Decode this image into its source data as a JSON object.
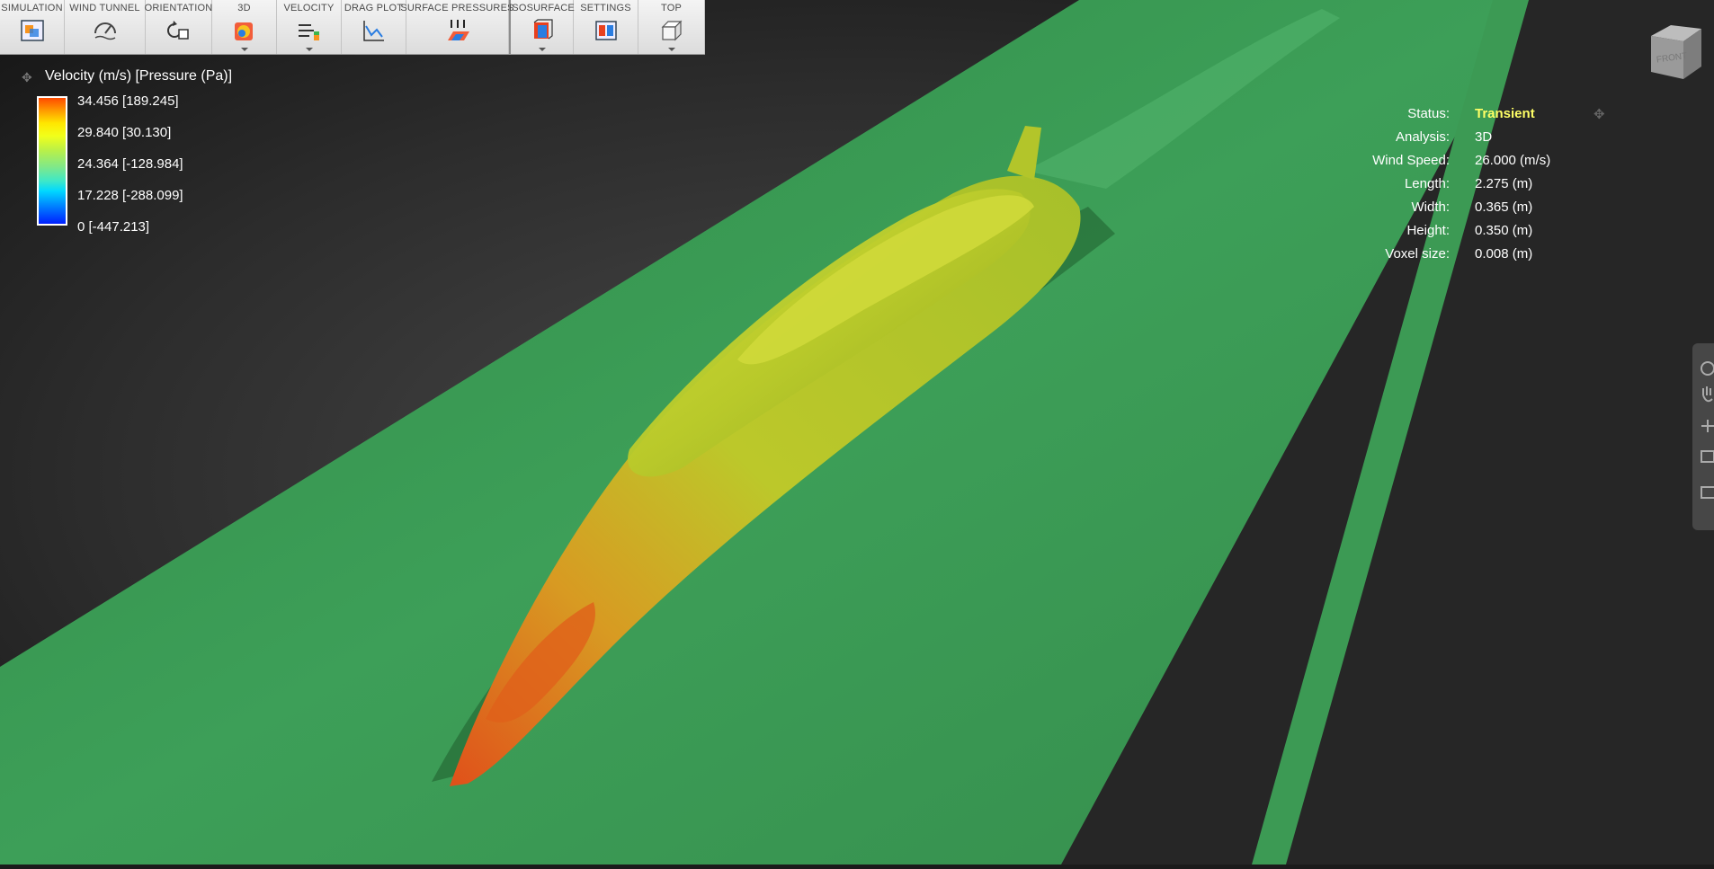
{
  "toolbar": {
    "items": [
      {
        "label": "SIMULATION",
        "icon": "simulation-icon"
      },
      {
        "label": "WIND TUNNEL",
        "icon": "wind-tunnel-icon"
      },
      {
        "label": "ORIENTATION",
        "icon": "orientation-icon"
      },
      {
        "label": "3D",
        "icon": "3d-view-icon"
      },
      {
        "label": "VELOCITY",
        "icon": "velocity-icon"
      },
      {
        "label": "DRAG PLOT",
        "icon": "drag-plot-icon"
      },
      {
        "label": "SURFACE PRESSURES",
        "icon": "surface-pressures-icon"
      },
      {
        "label": "ISOSURFACE",
        "icon": "isosurface-icon"
      },
      {
        "label": "SETTINGS",
        "icon": "settings-icon"
      },
      {
        "label": "TOP",
        "icon": "top-view-icon"
      }
    ]
  },
  "legend": {
    "title": "Velocity (m/s) [Pressure (Pa)]",
    "values": [
      "34.456 [189.245]",
      "29.840 [30.130]",
      "24.364 [-128.984]",
      "17.228 [-288.099]",
      "0 [-447.213]"
    ]
  },
  "status": {
    "rows": [
      {
        "label": "Status:",
        "value": "Transient"
      },
      {
        "label": "Analysis:",
        "value": "3D"
      },
      {
        "label": "Wind Speed:",
        "value": "26.000 (m/s)"
      },
      {
        "label": "Length:",
        "value": "2.275 (m)"
      },
      {
        "label": "Width:",
        "value": "0.365 (m)"
      },
      {
        "label": "Height:",
        "value": "0.350 (m)"
      },
      {
        "label": "Voxel size:",
        "value": "0.008 (m)"
      }
    ],
    "highlight_color": "#ffff66"
  },
  "viewcube": {
    "face_label": "FRONT"
  },
  "colors": {
    "ground_plane": "#3a9a54",
    "model_surface": "#b9cc2a",
    "background": "#1b1b1b"
  }
}
